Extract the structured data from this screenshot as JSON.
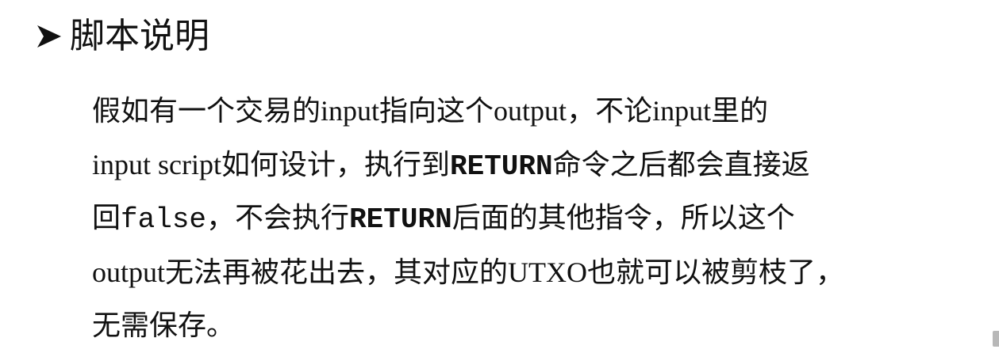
{
  "slide": {
    "heading": {
      "bullet_icon": "right-arrowhead-bullet",
      "text": "脚本说明"
    },
    "paragraph": {
      "lines": [
        [
          "假如有一个交易的",
          "input",
          "指向这个",
          "output",
          "，不论",
          "input",
          "里的"
        ],
        [
          "input script",
          "如何设计，执行到",
          "RETURN",
          "命令之后都会直接返"
        ],
        [
          "回",
          "false",
          "，不会执行",
          "RETURN",
          "后面的其他指令，所以这个"
        ],
        [
          "output",
          "无法再被花出去，其对应的",
          "UTXO",
          "也就可以被剪枝了，"
        ],
        [
          "无需保存。"
        ]
      ]
    }
  },
  "colors": {
    "text": "#111111",
    "background": "#ffffff",
    "scrollbar": "#b8b8b8"
  }
}
